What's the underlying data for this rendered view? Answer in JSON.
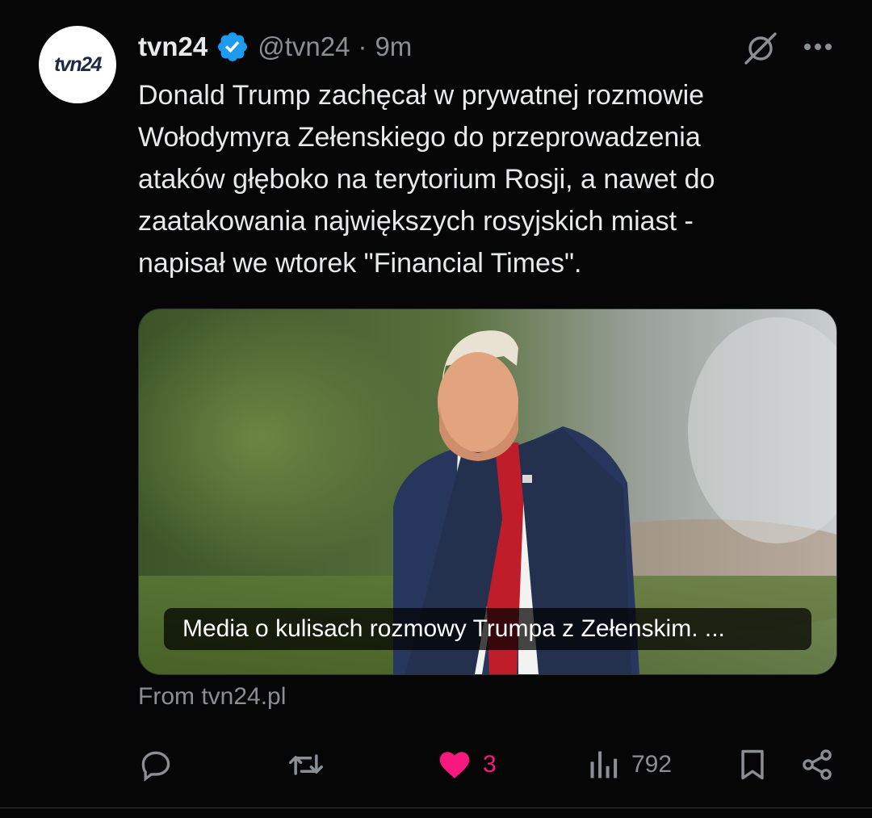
{
  "author": {
    "display_name": "tvn24",
    "handle": "@tvn24",
    "separator": "·",
    "time": "9m",
    "avatar_logo_text": "tvn24",
    "verified_color": "#1d9bf0"
  },
  "tweet": {
    "text": "Donald Trump zachęcał w prywatnej rozmowie\nWołodymyra Zełenskiego do przeprowadzenia\nataków głęboko na terytorium Rosji, a nawet do\nzaatakowania największych rosyjskich miast -\nnapisał we wtorek \"Financial Times\"."
  },
  "card": {
    "caption": "Media o kulisach rozmowy Trumpa z Zełenskim. ...",
    "source": "From tvn24.pl"
  },
  "actions": {
    "reply": {
      "icon": "reply-icon",
      "count": ""
    },
    "repost": {
      "icon": "repost-icon",
      "count": ""
    },
    "like": {
      "icon": "heart-filled-icon",
      "count": "3",
      "color": "#f91880"
    },
    "views": {
      "icon": "views-icon",
      "count": "792"
    },
    "bookmark": {
      "icon": "bookmark-icon"
    },
    "share": {
      "icon": "share-icon"
    }
  },
  "icons": {
    "grok": "grok-icon",
    "more": "more-icon"
  }
}
